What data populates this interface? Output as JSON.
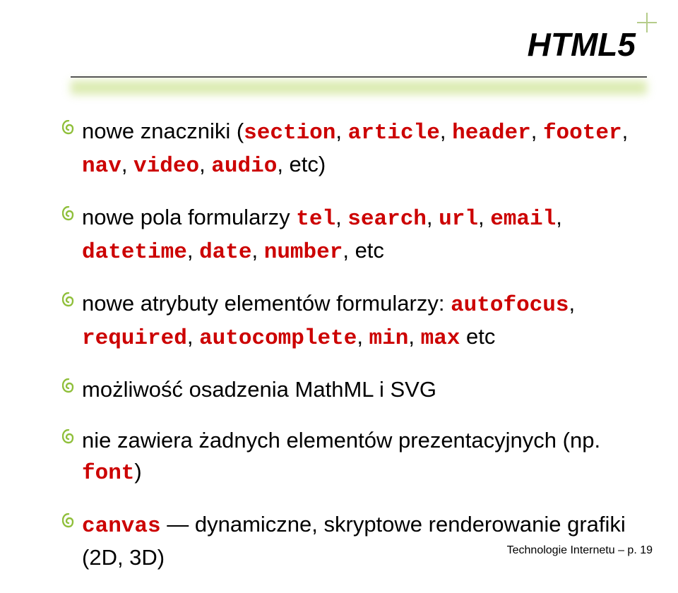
{
  "title": "HTML5",
  "items": [
    {
      "segments": [
        {
          "t": "nowe znaczniki (",
          "c": "plain"
        },
        {
          "t": "section",
          "c": "code"
        },
        {
          "t": ", ",
          "c": "plain"
        },
        {
          "t": "article",
          "c": "code"
        },
        {
          "t": ", ",
          "c": "plain"
        },
        {
          "t": "header",
          "c": "code"
        },
        {
          "t": ", ",
          "c": "plain"
        },
        {
          "t": "footer",
          "c": "code"
        },
        {
          "t": ", ",
          "c": "plain"
        },
        {
          "t": "nav",
          "c": "code"
        },
        {
          "t": ", ",
          "c": "plain"
        },
        {
          "t": "video",
          "c": "code"
        },
        {
          "t": ", ",
          "c": "plain"
        },
        {
          "t": "audio",
          "c": "code"
        },
        {
          "t": ", etc)",
          "c": "plain"
        }
      ]
    },
    {
      "segments": [
        {
          "t": "nowe pola formularzy ",
          "c": "plain"
        },
        {
          "t": "tel",
          "c": "code"
        },
        {
          "t": ", ",
          "c": "plain"
        },
        {
          "t": "search",
          "c": "code"
        },
        {
          "t": ", ",
          "c": "plain"
        },
        {
          "t": "url",
          "c": "code"
        },
        {
          "t": ", ",
          "c": "plain"
        },
        {
          "t": "email",
          "c": "code"
        },
        {
          "t": ", ",
          "c": "plain"
        },
        {
          "t": "datetime",
          "c": "code"
        },
        {
          "t": ", ",
          "c": "plain"
        },
        {
          "t": "date",
          "c": "code"
        },
        {
          "t": ", ",
          "c": "plain"
        },
        {
          "t": "number",
          "c": "code"
        },
        {
          "t": ", etc",
          "c": "plain"
        }
      ]
    },
    {
      "segments": [
        {
          "t": "nowe atrybuty elementów formularzy: ",
          "c": "plain"
        },
        {
          "t": "autofocus",
          "c": "code"
        },
        {
          "t": ", ",
          "c": "plain"
        },
        {
          "t": "required",
          "c": "code"
        },
        {
          "t": ", ",
          "c": "plain"
        },
        {
          "t": "autocomplete",
          "c": "code"
        },
        {
          "t": ", ",
          "c": "plain"
        },
        {
          "t": "min",
          "c": "code"
        },
        {
          "t": ", ",
          "c": "plain"
        },
        {
          "t": "max",
          "c": "code"
        },
        {
          "t": " etc",
          "c": "plain"
        }
      ]
    },
    {
      "segments": [
        {
          "t": "możliwość osadzenia MathML i SVG",
          "c": "plain"
        }
      ]
    },
    {
      "segments": [
        {
          "t": "nie zawiera żadnych elementów prezentacyjnych (np. ",
          "c": "plain"
        },
        {
          "t": "font",
          "c": "code"
        },
        {
          "t": ")",
          "c": "plain"
        }
      ]
    },
    {
      "segments": [
        {
          "t": "canvas",
          "c": "code"
        },
        {
          "t": " — dynamiczne, skryptowe renderowanie grafiki (2D, 3D)",
          "c": "plain"
        }
      ]
    }
  ],
  "footer": "Technologie Internetu – p. 19"
}
